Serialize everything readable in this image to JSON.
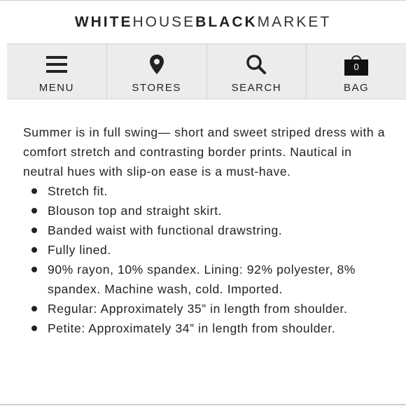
{
  "brand": {
    "part1": "WHITE",
    "part2": "HOUSE",
    "part3": "BLACK",
    "part4": "MARKET"
  },
  "nav": {
    "items": [
      {
        "label": "MENU",
        "icon": "hamburger-icon"
      },
      {
        "label": "STORES",
        "icon": "location-pin-icon"
      },
      {
        "label": "SEARCH",
        "icon": "search-icon"
      },
      {
        "label": "BAG",
        "icon": "shopping-bag-icon"
      }
    ],
    "bag_count": "0"
  },
  "description": {
    "intro": "Summer is in full swing— short and sweet striped dress with a comfort stretch and contrasting border prints. Nautical in neutral hues with slip-on ease is a must-have.",
    "bullets": [
      "Stretch fit.",
      "Blouson top and straight skirt.",
      "Banded waist with functional drawstring.",
      "Fully lined.",
      "90% rayon, 10% spandex. Lining: 92% polyester, 8% spandex. Machine wash, cold. Imported.",
      "Regular: Approximately 35” in length from shoulder.",
      "Petite: Approximately 34” in length from shoulder."
    ]
  }
}
